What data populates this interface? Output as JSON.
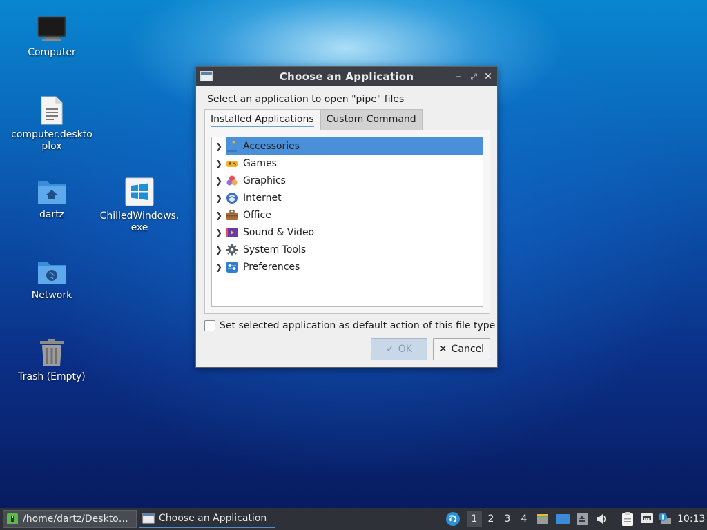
{
  "desktop": {
    "icons": [
      {
        "label": "Computer"
      },
      {
        "label": "computer.desktoplox"
      },
      {
        "label": "dartz"
      },
      {
        "label": "ChilledWindows.exe"
      },
      {
        "label": "Network"
      },
      {
        "label": "Trash (Empty)"
      }
    ]
  },
  "dialog": {
    "title": "Choose an Application",
    "prompt": "Select an application to open \"pipe\" files",
    "tabs": [
      {
        "label": "Installed Applications",
        "active": true
      },
      {
        "label": "Custom Command",
        "active": false
      }
    ],
    "categories": [
      {
        "label": "Accessories",
        "icon": "accessories-icon",
        "selected": true
      },
      {
        "label": "Games",
        "icon": "gamepad-icon"
      },
      {
        "label": "Graphics",
        "icon": "graphics-icon"
      },
      {
        "label": "Internet",
        "icon": "globe-icon"
      },
      {
        "label": "Office",
        "icon": "briefcase-icon"
      },
      {
        "label": "Sound & Video",
        "icon": "multimedia-icon"
      },
      {
        "label": "System Tools",
        "icon": "gear-icon"
      },
      {
        "label": "Preferences",
        "icon": "preferences-icon"
      }
    ],
    "default_checkbox_label": "Set selected application as default action of this file type",
    "default_checked": false,
    "ok_label": "OK",
    "cancel_label": "Cancel"
  },
  "taskbar": {
    "tasks": [
      {
        "label": "/home/dartz/Desktop..."
      },
      {
        "label": "Choose an Application"
      }
    ],
    "workspaces": [
      "1",
      "2",
      "3",
      "4"
    ],
    "active_workspace": "1",
    "clock": "10:13"
  },
  "colors": {
    "selection": "#4a90d9",
    "titlebar": "#3b3e44",
    "taskbar": "#2e3238"
  }
}
